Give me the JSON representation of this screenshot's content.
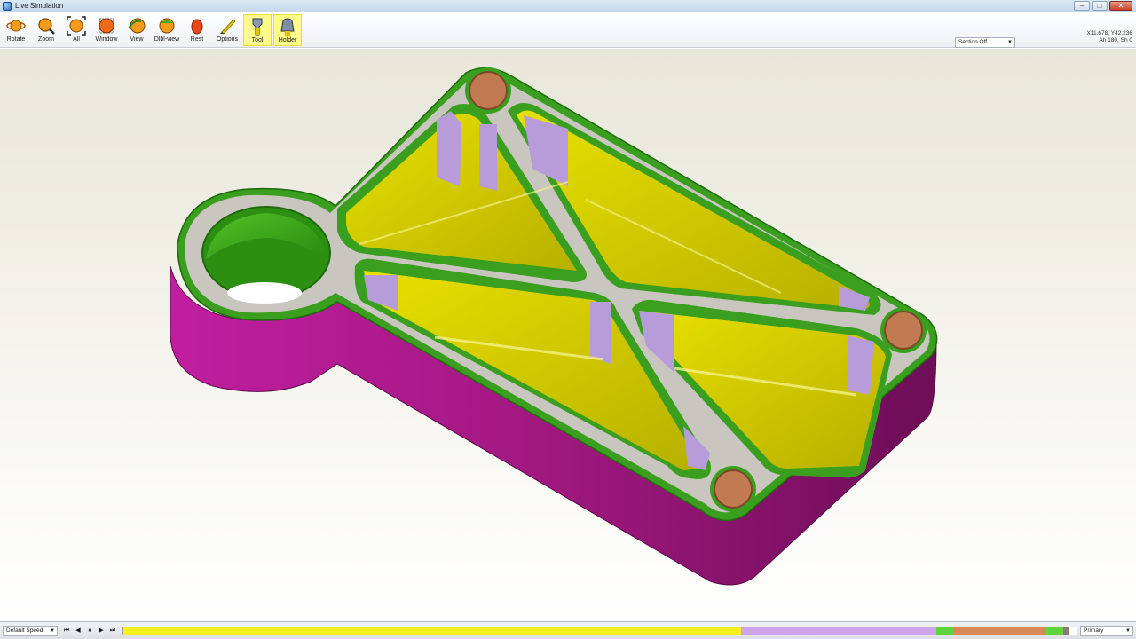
{
  "window": {
    "title": "Live Simulation",
    "controls": [
      "–",
      "□",
      "✕"
    ]
  },
  "toolbar": {
    "buttons": [
      {
        "label": "Rotate",
        "icon": "rotate-icon"
      },
      {
        "label": "Zoom",
        "icon": "zoom-icon"
      },
      {
        "label": "All",
        "icon": "zoom-all-icon"
      },
      {
        "label": "Window",
        "icon": "zoom-window-icon"
      },
      {
        "label": "View",
        "icon": "view-icon"
      },
      {
        "label": "Dlbl-view",
        "icon": "dlbl-view-icon"
      },
      {
        "label": "Rest",
        "icon": "rest-icon"
      },
      {
        "label": "Options",
        "icon": "options-icon"
      },
      {
        "label": "Tool",
        "icon": "tool-icon"
      },
      {
        "label": "Holder",
        "icon": "holder-icon"
      }
    ],
    "section_select": "Section Off",
    "coords_line1": "X11.678, Y42.236",
    "coords_line2": "Ah 180, Sh 0"
  },
  "bottombar": {
    "speed_select": "Default Speed",
    "playback": [
      "⏮",
      "◀",
      "⏸",
      "▶",
      "⏭"
    ],
    "timeline_segments": [
      {
        "fraction": 0.648,
        "color": "#f6ef1d"
      },
      {
        "fraction": 0.205,
        "color": "#cfa4ec"
      },
      {
        "fraction": 0.018,
        "color": "#5cd43a"
      },
      {
        "fraction": 0.097,
        "color": "#d7895a"
      },
      {
        "fraction": 0.018,
        "color": "#5cd43a"
      },
      {
        "fraction": 0.007,
        "color": "#8a7c70"
      },
      {
        "fraction": 0.007,
        "color": "#ffffff"
      }
    ],
    "primary_select": "Primary"
  },
  "colors": {
    "wall": "#a0187f",
    "rim": "#3a9f1e",
    "floor": "#d4cc00",
    "rib_top": "#c9c5bf",
    "side_face": "#b89bd9",
    "hole": "#c27a52"
  }
}
